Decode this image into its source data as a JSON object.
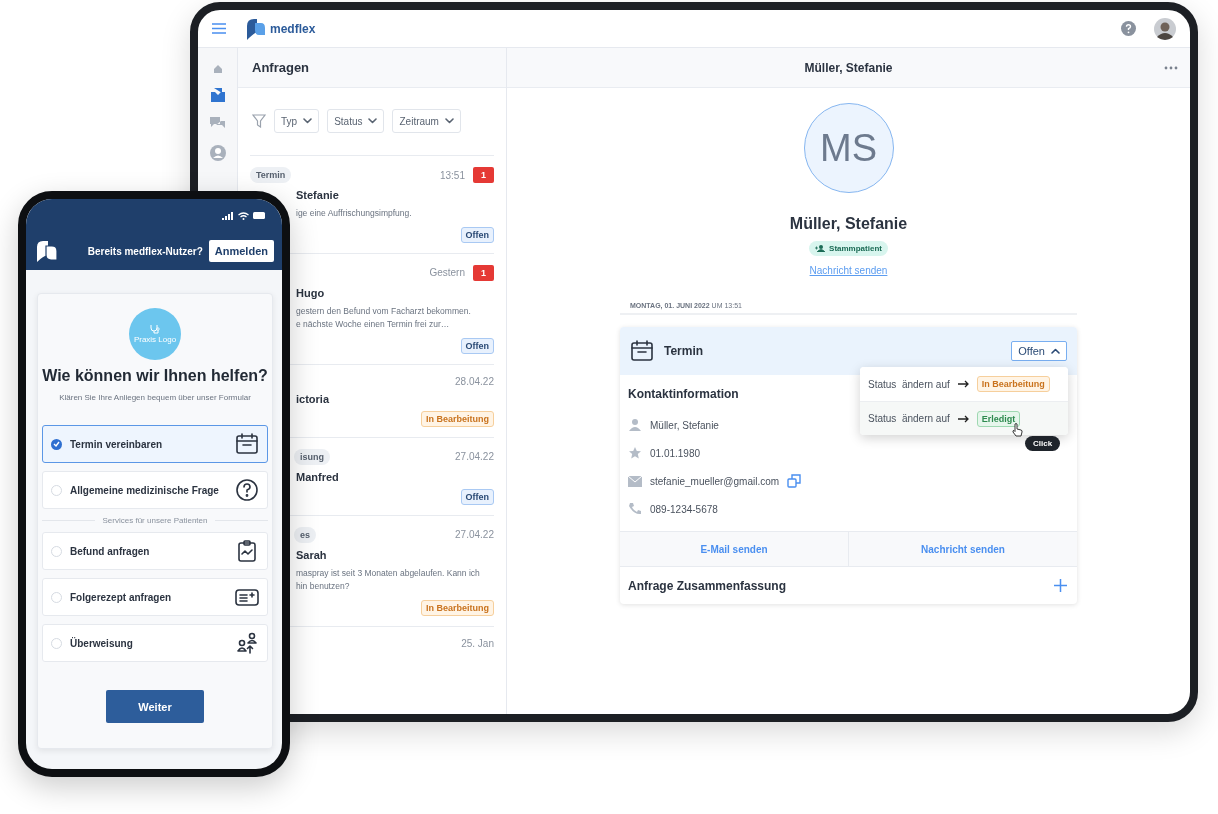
{
  "tablet": {
    "brand": "medflex",
    "sidebar": [
      {
        "selected": false
      },
      {
        "selected": true
      },
      {
        "selected": false
      },
      {
        "selected": false
      }
    ],
    "list": {
      "title": "Anfragen",
      "filters": [
        "Typ",
        "Status",
        "Zeitraum"
      ],
      "items": [
        {
          "tag": "Termin",
          "time": "13:51",
          "count": "1",
          "name": "Stefanie",
          "message": "ige eine Auffrischungsimpfung.",
          "status": {
            "label": "Offen",
            "kind": "open"
          }
        },
        {
          "time": "Gestern",
          "count": "1",
          "name": "Hugo",
          "message": "gestern den Befund vom Facharzt bekommen.\ne nächste Woche einen Termin frei zur…",
          "status": {
            "label": "Offen",
            "kind": "open"
          }
        },
        {
          "time": "28.04.22",
          "name": "ictoria",
          "status": {
            "label": "In Bearbeitung",
            "kind": "progress"
          }
        },
        {
          "tag": "isung",
          "time": "27.04.22",
          "name": "Manfred",
          "status": {
            "label": "Offen",
            "kind": "open"
          }
        },
        {
          "tag": "es",
          "time": "27.04.22",
          "name": "Sarah",
          "message": "maspray ist seit 3 Monaten abgelaufen. Kann ich\nhin benutzen?",
          "status": {
            "label": "In Bearbeitung",
            "kind": "progress"
          }
        },
        {
          "time": "25. Jan"
        }
      ]
    },
    "detail": {
      "header": "Müller, Stefanie",
      "initials": "MS",
      "name": "Müller, Stefanie",
      "badge": "Stammpatient",
      "link": "Nachricht senden",
      "date": "**MONTAG, 01. JUNI 2022** UM 13:51",
      "card": {
        "title": "Termin",
        "status": "Offen",
        "expanded": true,
        "menu": [
          {
            "prefix": "Status  ändern auf",
            "target": {
              "label": "In Bearbeitung",
              "kind": "progress"
            },
            "hovered": false
          },
          {
            "prefix": "Status  ändern auf",
            "target": {
              "label": "Erledigt",
              "kind": "done"
            },
            "hovered": true
          }
        ],
        "tooltip": "Click",
        "section": "Kontaktinformation",
        "contacts": [
          {
            "text": "Müller, Stefanie",
            "kind": "person"
          },
          {
            "text": "01.01.1980",
            "kind": "birthday"
          },
          {
            "text": "stefanie_mueller@gmail.com",
            "kind": "email"
          },
          {
            "text": "089-1234-5678",
            "kind": "phone"
          }
        ],
        "actions": [
          "E-Mail senden",
          "Nachricht senden"
        ],
        "summary": "Anfrage Zusammenfassung"
      }
    }
  },
  "phone": {
    "prompt": "Bereits medflex-Nutzer?",
    "login": "Anmelden",
    "logo_text": "Praxis Logo",
    "heading": "Wie können wir Ihnen helfen?",
    "subtitle": "Klären Sie Ihre Anliegen bequem über unser Formular",
    "options": [
      {
        "label": "Termin vereinbaren",
        "selected": true
      },
      {
        "label": "Allgemeine medizinische Frage",
        "selected": false
      }
    ],
    "section_label": "Services für unsere Patienten",
    "services": [
      {
        "label": "Befund anfragen",
        "selected": false
      },
      {
        "label": "Folgerezept anfragen",
        "selected": false
      },
      {
        "label": "Überweisung",
        "selected": false
      }
    ],
    "button": "Weiter"
  }
}
